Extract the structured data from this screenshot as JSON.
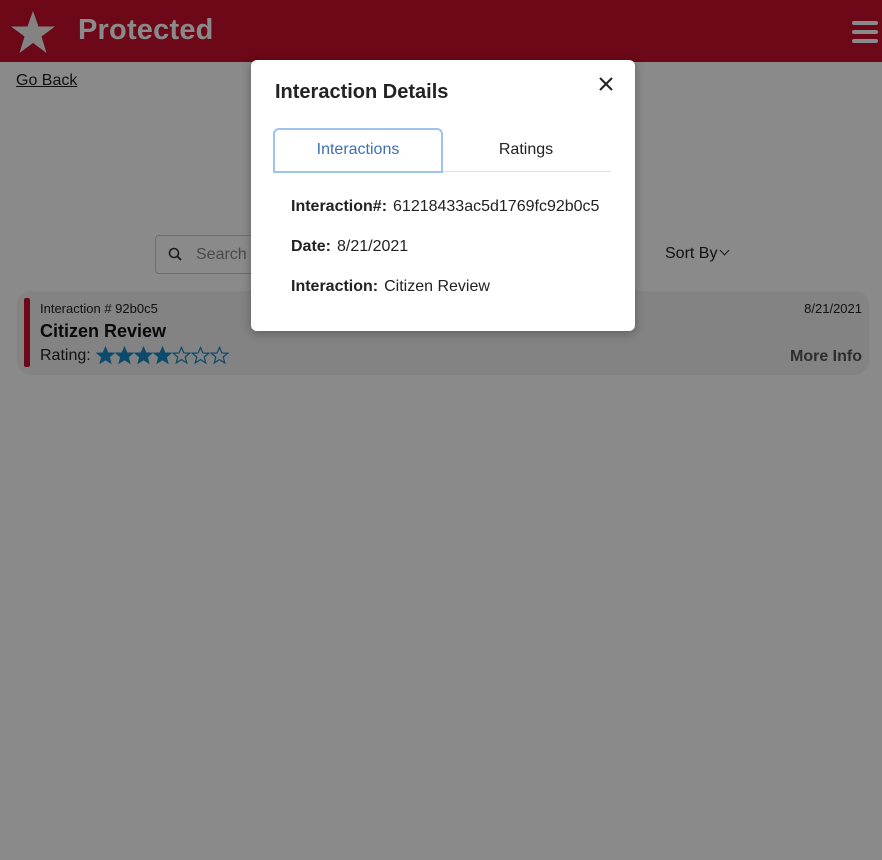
{
  "header": {
    "brand": "Protected",
    "logo_icon": "star-logo-icon",
    "menu_icon": "hamburger-menu-icon",
    "color": "#c8102e"
  },
  "page": {
    "go_back": "Go Back",
    "search_placeholder": "Search",
    "sort_by": "Sort By"
  },
  "card": {
    "interaction_number": "Interaction # 92b0c5",
    "title": "Citizen Review",
    "rating_label": "Rating:",
    "rating": 4,
    "rating_max": 7,
    "date": "8/21/2021",
    "more_info": "More Info",
    "accent": "#c8102e",
    "star_color": "#1a8ac6"
  },
  "modal": {
    "title": "Interaction Details",
    "tabs": [
      {
        "label": "Interactions",
        "active": true
      },
      {
        "label": "Ratings",
        "active": false
      }
    ],
    "details": [
      {
        "label": "Interaction#:",
        "value": "61218433ac5d1769fc92b0c5"
      },
      {
        "label": "Date:",
        "value": "8/21/2021"
      },
      {
        "label": "Interaction:",
        "value": "Citizen Review"
      }
    ]
  }
}
